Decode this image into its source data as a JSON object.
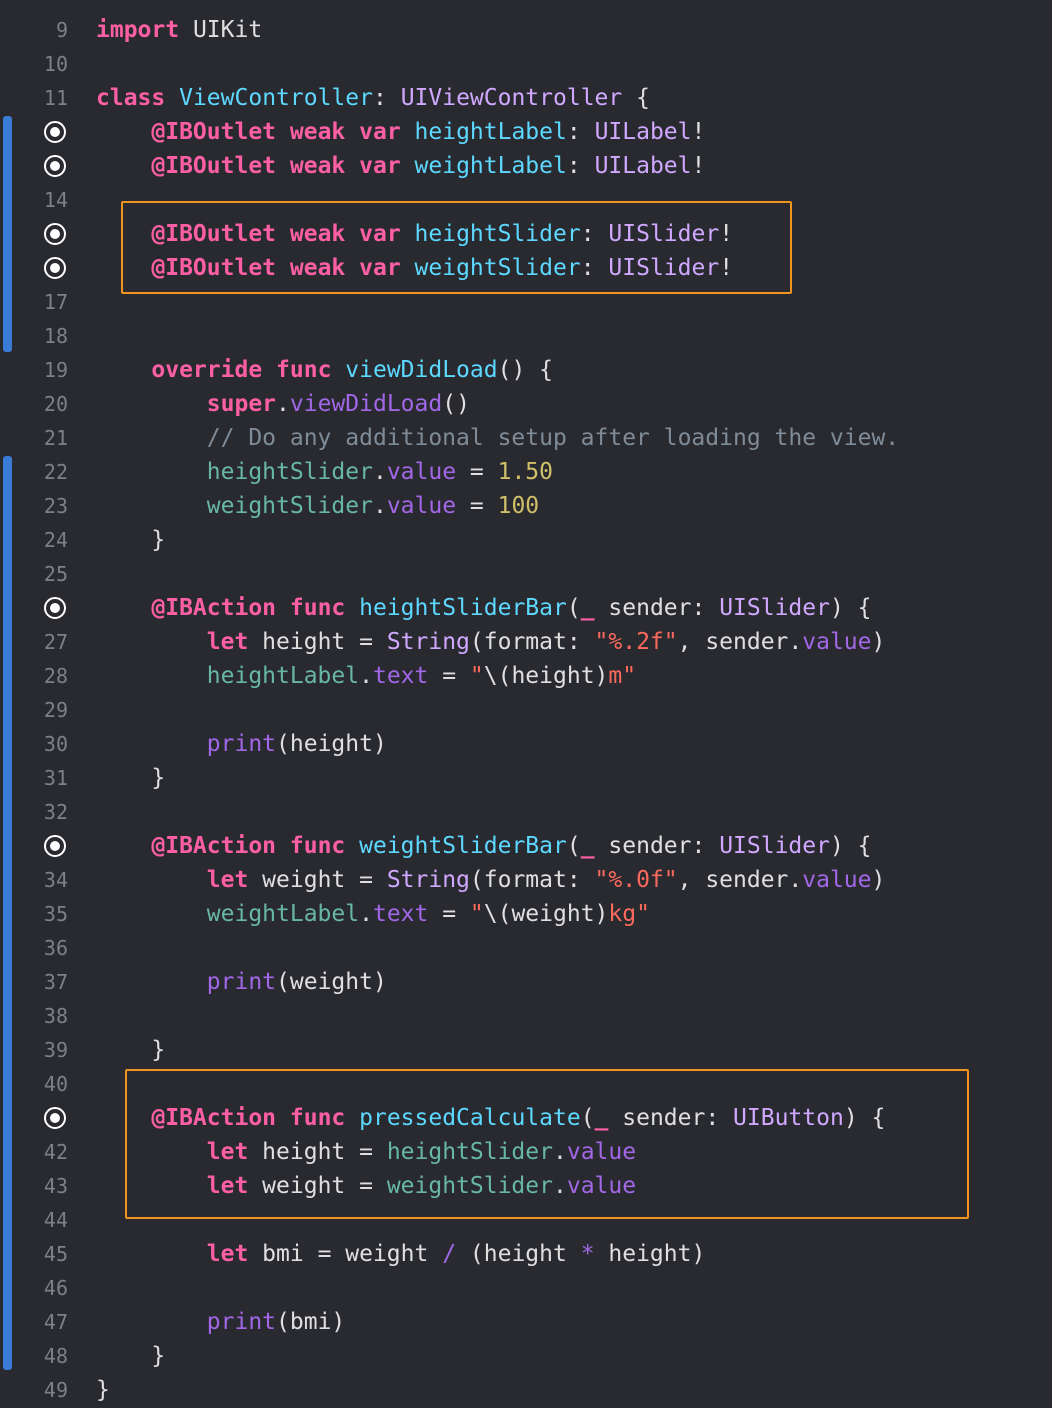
{
  "editor": {
    "language": "Swift",
    "colors": {
      "background": "#292a30",
      "keyword": "#fc5fa3",
      "type": "#d0a8ff",
      "declaration": "#5dd8ff",
      "project_property": "#67b7a4",
      "member": "#a167e6",
      "function": "#41a1c0",
      "string": "#fc6a5d",
      "number": "#d0bf69",
      "comment": "#7f8c98",
      "change_bar": "#3a7bd5",
      "highlight_box": "#f0941e"
    },
    "lines": [
      {
        "n": "9",
        "outlet": false,
        "tokens": [
          [
            "kw",
            "import"
          ],
          [
            "pl",
            " UIKit"
          ]
        ]
      },
      {
        "n": "10",
        "outlet": false,
        "tokens": []
      },
      {
        "n": "11",
        "outlet": false,
        "tokens": [
          [
            "kw",
            "class"
          ],
          [
            "pl",
            " "
          ],
          [
            "decl",
            "ViewController"
          ],
          [
            "pl",
            ": "
          ],
          [
            "ty",
            "UIViewController"
          ],
          [
            "pl",
            " {"
          ]
        ]
      },
      {
        "n": "12",
        "outlet": true,
        "tokens": [
          [
            "pl",
            "    "
          ],
          [
            "kw",
            "@IBOutlet"
          ],
          [
            "pl",
            " "
          ],
          [
            "kw",
            "weak"
          ],
          [
            "pl",
            " "
          ],
          [
            "kw",
            "var"
          ],
          [
            "pl",
            " "
          ],
          [
            "decl",
            "heightLabel"
          ],
          [
            "pl",
            ": "
          ],
          [
            "ty",
            "UILabel"
          ],
          [
            "pl",
            "!"
          ]
        ]
      },
      {
        "n": "13",
        "outlet": true,
        "tokens": [
          [
            "pl",
            "    "
          ],
          [
            "kw",
            "@IBOutlet"
          ],
          [
            "pl",
            " "
          ],
          [
            "kw",
            "weak"
          ],
          [
            "pl",
            " "
          ],
          [
            "kw",
            "var"
          ],
          [
            "pl",
            " "
          ],
          [
            "decl",
            "weightLabel"
          ],
          [
            "pl",
            ": "
          ],
          [
            "ty",
            "UILabel"
          ],
          [
            "pl",
            "!"
          ]
        ]
      },
      {
        "n": "14",
        "outlet": false,
        "tokens": []
      },
      {
        "n": "15",
        "outlet": true,
        "tokens": [
          [
            "pl",
            "    "
          ],
          [
            "kw",
            "@IBOutlet"
          ],
          [
            "pl",
            " "
          ],
          [
            "kw",
            "weak"
          ],
          [
            "pl",
            " "
          ],
          [
            "kw",
            "var"
          ],
          [
            "pl",
            " "
          ],
          [
            "decl",
            "heightSlider"
          ],
          [
            "pl",
            ": "
          ],
          [
            "ty",
            "UISlider"
          ],
          [
            "pl",
            "!"
          ]
        ]
      },
      {
        "n": "16",
        "outlet": true,
        "tokens": [
          [
            "pl",
            "    "
          ],
          [
            "kw",
            "@IBOutlet"
          ],
          [
            "pl",
            " "
          ],
          [
            "kw",
            "weak"
          ],
          [
            "pl",
            " "
          ],
          [
            "kw",
            "var"
          ],
          [
            "pl",
            " "
          ],
          [
            "decl",
            "weightSlider"
          ],
          [
            "pl",
            ": "
          ],
          [
            "ty",
            "UISlider"
          ],
          [
            "pl",
            "!"
          ]
        ]
      },
      {
        "n": "17",
        "outlet": false,
        "tokens": []
      },
      {
        "n": "18",
        "outlet": false,
        "tokens": []
      },
      {
        "n": "19",
        "outlet": false,
        "tokens": [
          [
            "pl",
            "    "
          ],
          [
            "kw",
            "override"
          ],
          [
            "pl",
            " "
          ],
          [
            "kw",
            "func"
          ],
          [
            "pl",
            " "
          ],
          [
            "decl",
            "viewDidLoad"
          ],
          [
            "pl",
            "() {"
          ]
        ]
      },
      {
        "n": "20",
        "outlet": false,
        "tokens": [
          [
            "pl",
            "        "
          ],
          [
            "kw",
            "super"
          ],
          [
            "pl",
            "."
          ],
          [
            "mem",
            "viewDidLoad"
          ],
          [
            "pl",
            "()"
          ]
        ]
      },
      {
        "n": "21",
        "outlet": false,
        "tokens": [
          [
            "pl",
            "        "
          ],
          [
            "cmt",
            "// Do any additional setup after loading the view."
          ]
        ]
      },
      {
        "n": "22",
        "outlet": false,
        "tokens": [
          [
            "pl",
            "        "
          ],
          [
            "prop",
            "heightSlider"
          ],
          [
            "pl",
            "."
          ],
          [
            "mem",
            "value"
          ],
          [
            "pl",
            " = "
          ],
          [
            "num",
            "1.50"
          ]
        ]
      },
      {
        "n": "23",
        "outlet": false,
        "tokens": [
          [
            "pl",
            "        "
          ],
          [
            "prop",
            "weightSlider"
          ],
          [
            "pl",
            "."
          ],
          [
            "mem",
            "value"
          ],
          [
            "pl",
            " = "
          ],
          [
            "num",
            "100"
          ]
        ]
      },
      {
        "n": "24",
        "outlet": false,
        "tokens": [
          [
            "pl",
            "    }"
          ]
        ]
      },
      {
        "n": "25",
        "outlet": false,
        "tokens": []
      },
      {
        "n": "26",
        "outlet": true,
        "tokens": [
          [
            "pl",
            "    "
          ],
          [
            "kw",
            "@IBAction"
          ],
          [
            "pl",
            " "
          ],
          [
            "kw",
            "func"
          ],
          [
            "pl",
            " "
          ],
          [
            "decl",
            "heightSliderBar"
          ],
          [
            "pl",
            "("
          ],
          [
            "kw",
            "_"
          ],
          [
            "pl",
            " sender: "
          ],
          [
            "ty",
            "UISlider"
          ],
          [
            "pl",
            ") {"
          ]
        ]
      },
      {
        "n": "27",
        "outlet": false,
        "tokens": [
          [
            "pl",
            "        "
          ],
          [
            "kw",
            "let"
          ],
          [
            "pl",
            " height = "
          ],
          [
            "ty",
            "String"
          ],
          [
            "pl",
            "(format: "
          ],
          [
            "str",
            "\"%.2f\""
          ],
          [
            "pl",
            ", sender."
          ],
          [
            "mem",
            "value"
          ],
          [
            "pl",
            ")"
          ]
        ]
      },
      {
        "n": "28",
        "outlet": false,
        "tokens": [
          [
            "pl",
            "        "
          ],
          [
            "prop",
            "heightLabel"
          ],
          [
            "pl",
            "."
          ],
          [
            "mem",
            "text"
          ],
          [
            "pl",
            " = "
          ],
          [
            "str",
            "\""
          ],
          [
            "pl",
            "\\(height)"
          ],
          [
            "str",
            "m\""
          ]
        ]
      },
      {
        "n": "29",
        "outlet": false,
        "tokens": []
      },
      {
        "n": "30",
        "outlet": false,
        "tokens": [
          [
            "pl",
            "        "
          ],
          [
            "mem",
            "print"
          ],
          [
            "pl",
            "(height)"
          ]
        ]
      },
      {
        "n": "31",
        "outlet": false,
        "tokens": [
          [
            "pl",
            "    }"
          ]
        ]
      },
      {
        "n": "32",
        "outlet": false,
        "tokens": []
      },
      {
        "n": "33",
        "outlet": true,
        "tokens": [
          [
            "pl",
            "    "
          ],
          [
            "kw",
            "@IBAction"
          ],
          [
            "pl",
            " "
          ],
          [
            "kw",
            "func"
          ],
          [
            "pl",
            " "
          ],
          [
            "decl",
            "weightSliderBar"
          ],
          [
            "pl",
            "("
          ],
          [
            "kw",
            "_"
          ],
          [
            "pl",
            " sender: "
          ],
          [
            "ty",
            "UISlider"
          ],
          [
            "pl",
            ") {"
          ]
        ]
      },
      {
        "n": "34",
        "outlet": false,
        "tokens": [
          [
            "pl",
            "        "
          ],
          [
            "kw",
            "let"
          ],
          [
            "pl",
            " weight = "
          ],
          [
            "ty",
            "String"
          ],
          [
            "pl",
            "(format: "
          ],
          [
            "str",
            "\"%.0f\""
          ],
          [
            "pl",
            ", sender."
          ],
          [
            "mem",
            "value"
          ],
          [
            "pl",
            ")"
          ]
        ]
      },
      {
        "n": "35",
        "outlet": false,
        "tokens": [
          [
            "pl",
            "        "
          ],
          [
            "prop",
            "weightLabel"
          ],
          [
            "pl",
            "."
          ],
          [
            "mem",
            "text"
          ],
          [
            "pl",
            " = "
          ],
          [
            "str",
            "\""
          ],
          [
            "pl",
            "\\(weight)"
          ],
          [
            "str",
            "kg\""
          ]
        ]
      },
      {
        "n": "36",
        "outlet": false,
        "tokens": []
      },
      {
        "n": "37",
        "outlet": false,
        "tokens": [
          [
            "pl",
            "        "
          ],
          [
            "mem",
            "print"
          ],
          [
            "pl",
            "(weight)"
          ]
        ]
      },
      {
        "n": "38",
        "outlet": false,
        "tokens": []
      },
      {
        "n": "39",
        "outlet": false,
        "tokens": [
          [
            "pl",
            "    }"
          ]
        ]
      },
      {
        "n": "40",
        "outlet": false,
        "tokens": []
      },
      {
        "n": "41",
        "outlet": true,
        "tokens": [
          [
            "pl",
            "    "
          ],
          [
            "kw",
            "@IBAction"
          ],
          [
            "pl",
            " "
          ],
          [
            "kw",
            "func"
          ],
          [
            "pl",
            " "
          ],
          [
            "decl",
            "pressedCalculate"
          ],
          [
            "pl",
            "("
          ],
          [
            "kw",
            "_"
          ],
          [
            "pl",
            " sender: "
          ],
          [
            "ty",
            "UIButton"
          ],
          [
            "pl",
            ") {"
          ]
        ]
      },
      {
        "n": "42",
        "outlet": false,
        "tokens": [
          [
            "pl",
            "        "
          ],
          [
            "kw",
            "let"
          ],
          [
            "pl",
            " height = "
          ],
          [
            "prop",
            "heightSlider"
          ],
          [
            "pl",
            "."
          ],
          [
            "mem",
            "value"
          ]
        ]
      },
      {
        "n": "43",
        "outlet": false,
        "tokens": [
          [
            "pl",
            "        "
          ],
          [
            "kw",
            "let"
          ],
          [
            "pl",
            " weight = "
          ],
          [
            "prop",
            "weightSlider"
          ],
          [
            "pl",
            "."
          ],
          [
            "mem",
            "value"
          ]
        ]
      },
      {
        "n": "44",
        "outlet": false,
        "tokens": []
      },
      {
        "n": "45",
        "outlet": false,
        "tokens": [
          [
            "pl",
            "        "
          ],
          [
            "kw",
            "let"
          ],
          [
            "pl",
            " bmi = weight "
          ],
          [
            "mem",
            "/"
          ],
          [
            "pl",
            " (height "
          ],
          [
            "mem",
            "*"
          ],
          [
            "pl",
            " height)"
          ]
        ]
      },
      {
        "n": "46",
        "outlet": false,
        "tokens": []
      },
      {
        "n": "47",
        "outlet": false,
        "tokens": [
          [
            "pl",
            "        "
          ],
          [
            "mem",
            "print"
          ],
          [
            "pl",
            "(bmi)"
          ]
        ]
      },
      {
        "n": "48",
        "outlet": false,
        "tokens": [
          [
            "pl",
            "    }"
          ]
        ]
      },
      {
        "n": "49",
        "outlet": false,
        "tokens": [
          [
            "pl",
            "}"
          ]
        ]
      }
    ]
  }
}
